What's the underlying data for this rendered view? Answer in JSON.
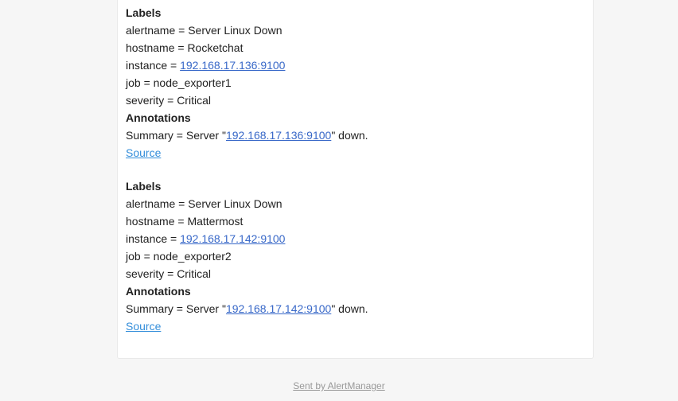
{
  "alerts": [
    {
      "labels_heading": "Labels",
      "alertname": "alertname = Server Linux Down",
      "hostname": "hostname = Rocketchat",
      "instance_prefix": "instance = ",
      "instance_value": "192.168.17.136:9100",
      "job": "job = node_exporter1",
      "severity": "severity = Critical",
      "annotations_heading": "Annotations",
      "summary_prefix": "Summary = Server \"",
      "summary_ip": "192.168.17.136:9100",
      "summary_suffix": "\" down.",
      "source_link": "Source"
    },
    {
      "labels_heading": "Labels",
      "alertname": "alertname = Server Linux Down",
      "hostname": "hostname = Mattermost",
      "instance_prefix": "instance = ",
      "instance_value": "192.168.17.142:9100",
      "job": "job = node_exporter2",
      "severity": "severity = Critical",
      "annotations_heading": "Annotations",
      "summary_prefix": "Summary = Server \"",
      "summary_ip": "192.168.17.142:9100",
      "summary_suffix": "\" down.",
      "source_link": "Source"
    }
  ],
  "footer": {
    "text": "Sent by AlertManager"
  },
  "colors": {
    "background": "#f6f6f6",
    "card": "#ffffff",
    "link": "#348eda",
    "ip_link": "#3868c8",
    "footer": "#999999"
  }
}
